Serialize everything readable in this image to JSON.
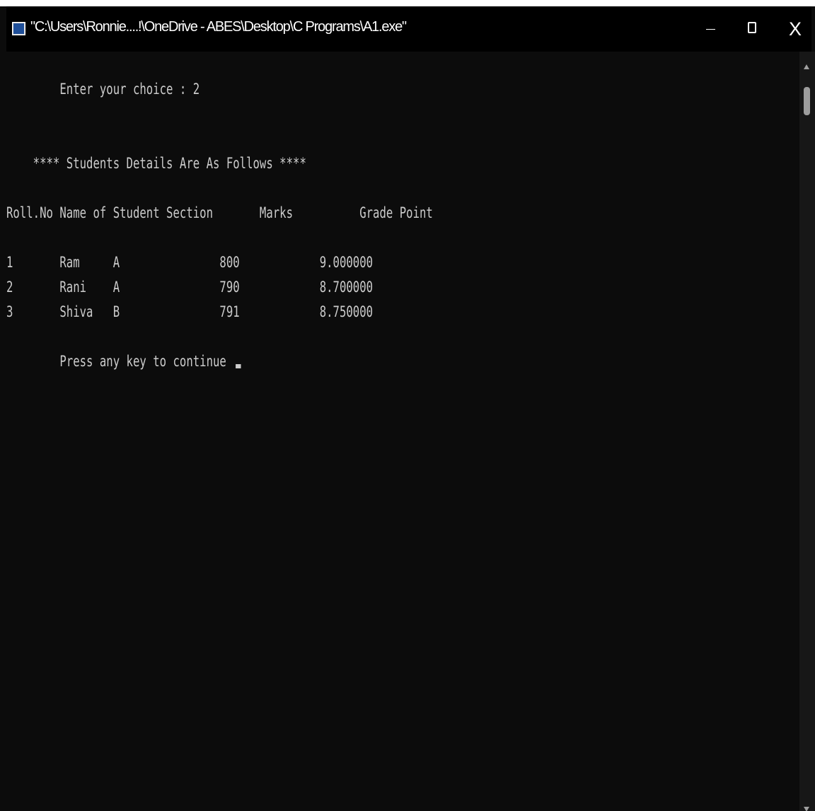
{
  "window": {
    "title": "\"C:\\Users\\Ronnie....!\\OneDrive - ABES\\Desktop\\C Programs\\A1.exe\"",
    "icon": "console-app-icon",
    "controls": {
      "minimize": "minimize-icon",
      "maximize": "maximize-icon",
      "close_label": "X"
    }
  },
  "console": {
    "lines": [
      "        Enter your choice : 2",
      "    **** Students Details Are As Follows ****",
      "Roll.No Name of Student Section       Marks          Grade Point",
      "1       Ram     A               800            9.000000",
      "2       Rani    A               790            8.700000",
      "3       Shiva   B               791            8.750000",
      "        Press any key to continue "
    ],
    "colors": {
      "background": "#0c0c0c",
      "foreground": "#cccccc"
    }
  }
}
